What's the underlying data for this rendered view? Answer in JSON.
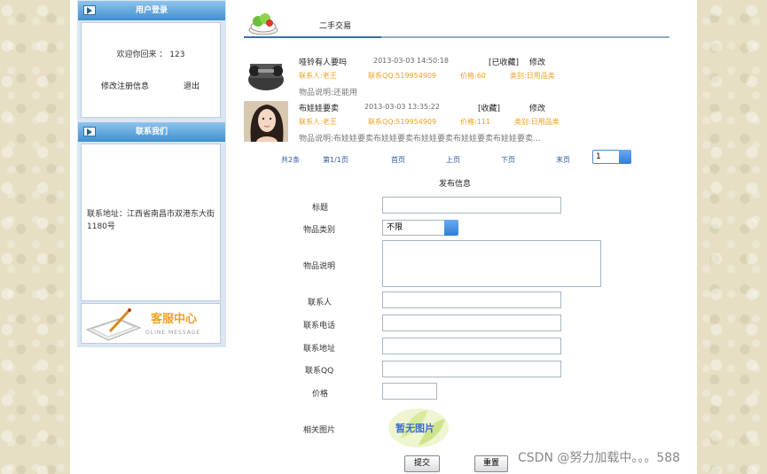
{
  "sidebar": {
    "login_box": {
      "title": "用户登录",
      "welcome": "欢迎你回来 ： 123",
      "edit_profile": "修改注册信息",
      "logout": "退出"
    },
    "contact_box": {
      "title": "联系我们",
      "address": "联系地址：江西省南昌市双港东大街1180号"
    },
    "service_banner": {
      "title": "客服中心",
      "subtitle": "OLINE MESSAGE"
    }
  },
  "main": {
    "section_title": "二手交易",
    "items": [
      {
        "name": "哑铃有人要吗",
        "date": "2013-03-03 14:50:18",
        "status": "[已收藏]",
        "edit": "修改",
        "contact": "联系人:老王",
        "qq": "联系QQ:519954909",
        "price": "价格:60",
        "category": "类别:日用品类",
        "desc": "物品说明:还能用"
      },
      {
        "name": "布娃娃要卖",
        "date": "2013-03-03 13:35:22",
        "status": "[收藏]",
        "edit": "修改",
        "contact": "联系人:老王",
        "qq": "联系QQ:519954909",
        "price": "价格:111",
        "category": "类别:日用品类",
        "desc": "物品说明:布娃娃要卖布娃娃要卖布娃娃要卖布娃娃要卖布娃娃要卖..."
      }
    ],
    "pager": {
      "total": "共2条",
      "page_info": "第1/1页",
      "first": "首页",
      "prev": "上页",
      "next": "下页",
      "last": "末页",
      "current": "1"
    },
    "form": {
      "title": "发布信息",
      "labels": {
        "title": "标题",
        "category": "物品类别",
        "description": "物品说明",
        "contact": "联系人",
        "phone": "联系电话",
        "address": "联系地址",
        "qq": "联系QQ",
        "price": "价格",
        "image": "相关图片"
      },
      "category_value": "不限",
      "no_image": "暂无图片",
      "submit": "提交",
      "reset": "重置"
    }
  },
  "watermark": "CSDN @努力加载中。。。588",
  "colors": {
    "accent_blue": "#3f8fcf",
    "orange": "#f0a020",
    "link_blue": "#2a5a9c"
  }
}
